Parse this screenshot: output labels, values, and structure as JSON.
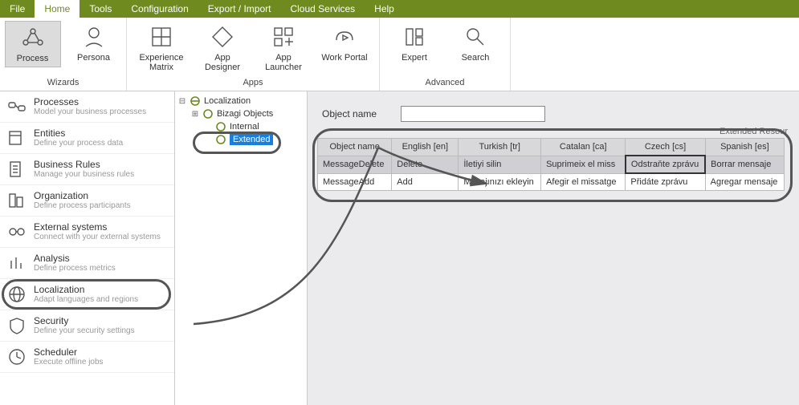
{
  "menus": [
    "File",
    "Home",
    "Tools",
    "Configuration",
    "Export / Import",
    "Cloud Services",
    "Help"
  ],
  "active_menu": 1,
  "ribbon": {
    "groups": [
      {
        "label": "Wizards",
        "items": [
          {
            "label": "Process",
            "selected": true
          },
          {
            "label": "Persona"
          }
        ]
      },
      {
        "label": "Apps",
        "items": [
          {
            "label": "Experience Matrix"
          },
          {
            "label": "App Designer"
          },
          {
            "label": "App Launcher"
          },
          {
            "label": "Work Portal"
          }
        ]
      },
      {
        "label": "Advanced",
        "items": [
          {
            "label": "Expert"
          },
          {
            "label": "Search"
          }
        ]
      }
    ]
  },
  "sidebar": [
    {
      "title": "Processes",
      "sub": "Model your business processes"
    },
    {
      "title": "Entities",
      "sub": "Define your process data"
    },
    {
      "title": "Business Rules",
      "sub": "Manage your business rules"
    },
    {
      "title": "Organization",
      "sub": "Define process participants"
    },
    {
      "title": "External systems",
      "sub": "Connect with your external systems"
    },
    {
      "title": "Analysis",
      "sub": "Define process metrics"
    },
    {
      "title": "Localization",
      "sub": "Adapt languages and regions",
      "highlight": true
    },
    {
      "title": "Security",
      "sub": "Define your security settings"
    },
    {
      "title": "Scheduler",
      "sub": "Execute offline jobs"
    }
  ],
  "tree": {
    "root": "Localization",
    "children": [
      {
        "label": "Bizagi Objects",
        "exp": "+"
      },
      {
        "label": "Internal",
        "exp": ""
      },
      {
        "label": "Extended",
        "exp": "",
        "selected": true
      }
    ]
  },
  "form": {
    "object_name_label": "Object name",
    "object_name_value": ""
  },
  "table": {
    "corner": "Extended Resour",
    "headers": [
      "Object name",
      "English [en]",
      "Turkish [tr]",
      "Catalan [ca]",
      "Czech [cs]",
      "Spanish [es]"
    ],
    "rows": [
      {
        "cells": [
          "MessageDelete",
          "Delete",
          "İletiyi silin",
          "Suprimeix el miss",
          "Odstraňte zprávu",
          "Borrar mensaje"
        ],
        "selected": true,
        "edit_col": 4
      },
      {
        "cells": [
          "MessageAdd",
          "Add",
          "Mesajınızı ekleyin",
          "Afegir el missatge",
          "Přidáte zprávu",
          "Agregar mensaje"
        ]
      }
    ]
  }
}
